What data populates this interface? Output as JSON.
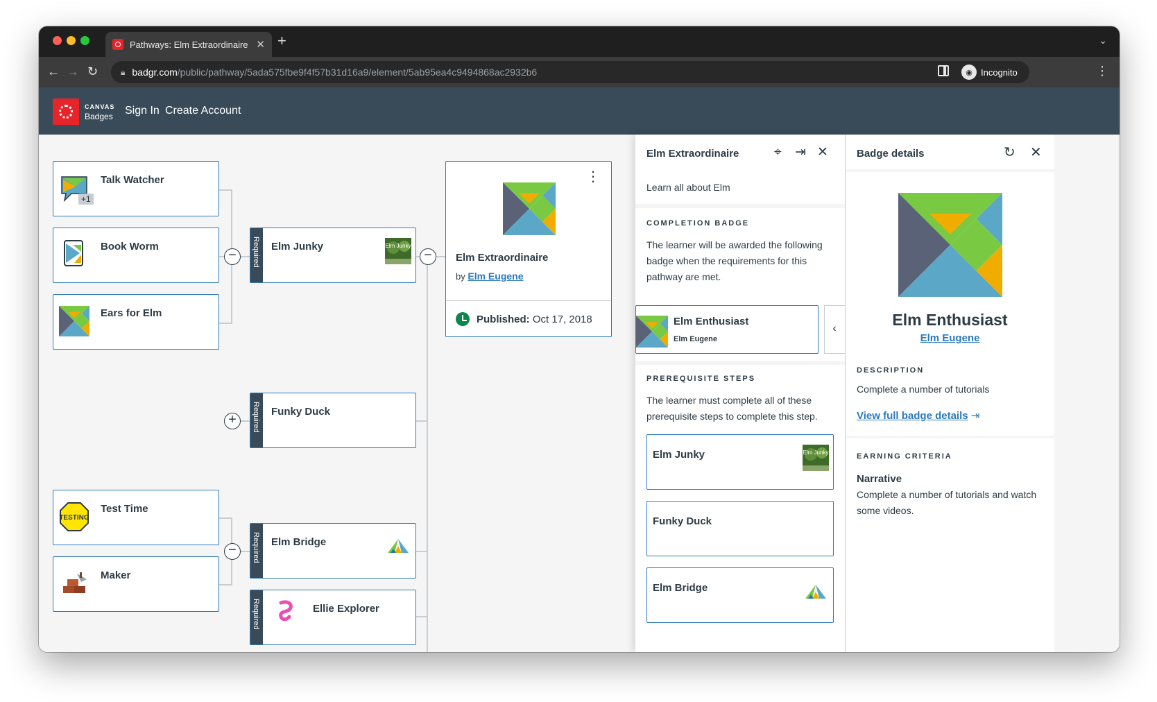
{
  "browser": {
    "tab_title": "Pathways: Elm Extraordinaire -",
    "url_domain": "badgr.com",
    "url_path": "/public/pathway/5ada575fbe9f4f57b31d16a9/element/5ab95ea4c9494868ac2932b6",
    "profile_label": "Incognito"
  },
  "header": {
    "logo_line1": "CANVAS",
    "logo_line2": "Badges",
    "sign_in": "Sign In",
    "create_account": "Create Account"
  },
  "pathway": {
    "required_label": "Required",
    "badge_plus": "+1",
    "left_nodes": [
      {
        "title": "Talk Watcher"
      },
      {
        "title": "Book Worm"
      },
      {
        "title": "Ears for Elm"
      },
      {
        "title": "Test Time",
        "image_text": "TESTING"
      },
      {
        "title": "Maker"
      }
    ],
    "mid_nodes": [
      {
        "title": "Elm Junky",
        "image_text": "Elm Junky"
      },
      {
        "title": "Funky Duck"
      },
      {
        "title": "Elm Bridge"
      },
      {
        "title": "Ellie Explorer"
      }
    ],
    "main_card": {
      "title": "Elm Extraordinaire",
      "by_prefix": "by",
      "issuer": "Elm Eugene",
      "published_label": "Published:",
      "published_date": "Oct 17, 2018"
    }
  },
  "detail_panel": {
    "title": "Elm Extraordinaire",
    "description": "Learn all about Elm",
    "completion_label": "COMPLETION BADGE",
    "completion_text": "The learner will be awarded the following badge when the requirements for this pathway are met.",
    "completion_badge_name": "Elm Enthusiast",
    "completion_badge_issuer": "Elm Eugene",
    "prereq_label": "PREREQUISITE STEPS",
    "prereq_text": "The learner must complete all of these prerequisite steps to complete this step.",
    "steps": [
      {
        "title": "Elm Junky",
        "image_text": "Elm Junky"
      },
      {
        "title": "Funky Duck"
      },
      {
        "title": "Elm Bridge"
      }
    ]
  },
  "badge_panel": {
    "title": "Badge details",
    "badge_name": "Elm Enthusiast",
    "issuer": "Elm Eugene",
    "description_label": "DESCRIPTION",
    "description": "Complete a number of tutorials",
    "view_link": "View full badge details",
    "criteria_label": "EARNING CRITERIA",
    "narrative_heading": "Narrative",
    "narrative_text": "Complete a number of tutorials and watch some videos."
  },
  "colors": {
    "header_bg": "#394b58",
    "link": "#2b7abc",
    "card_border": "#2b7abc",
    "brand_red": "#e72429",
    "published_green": "#0b874b"
  }
}
